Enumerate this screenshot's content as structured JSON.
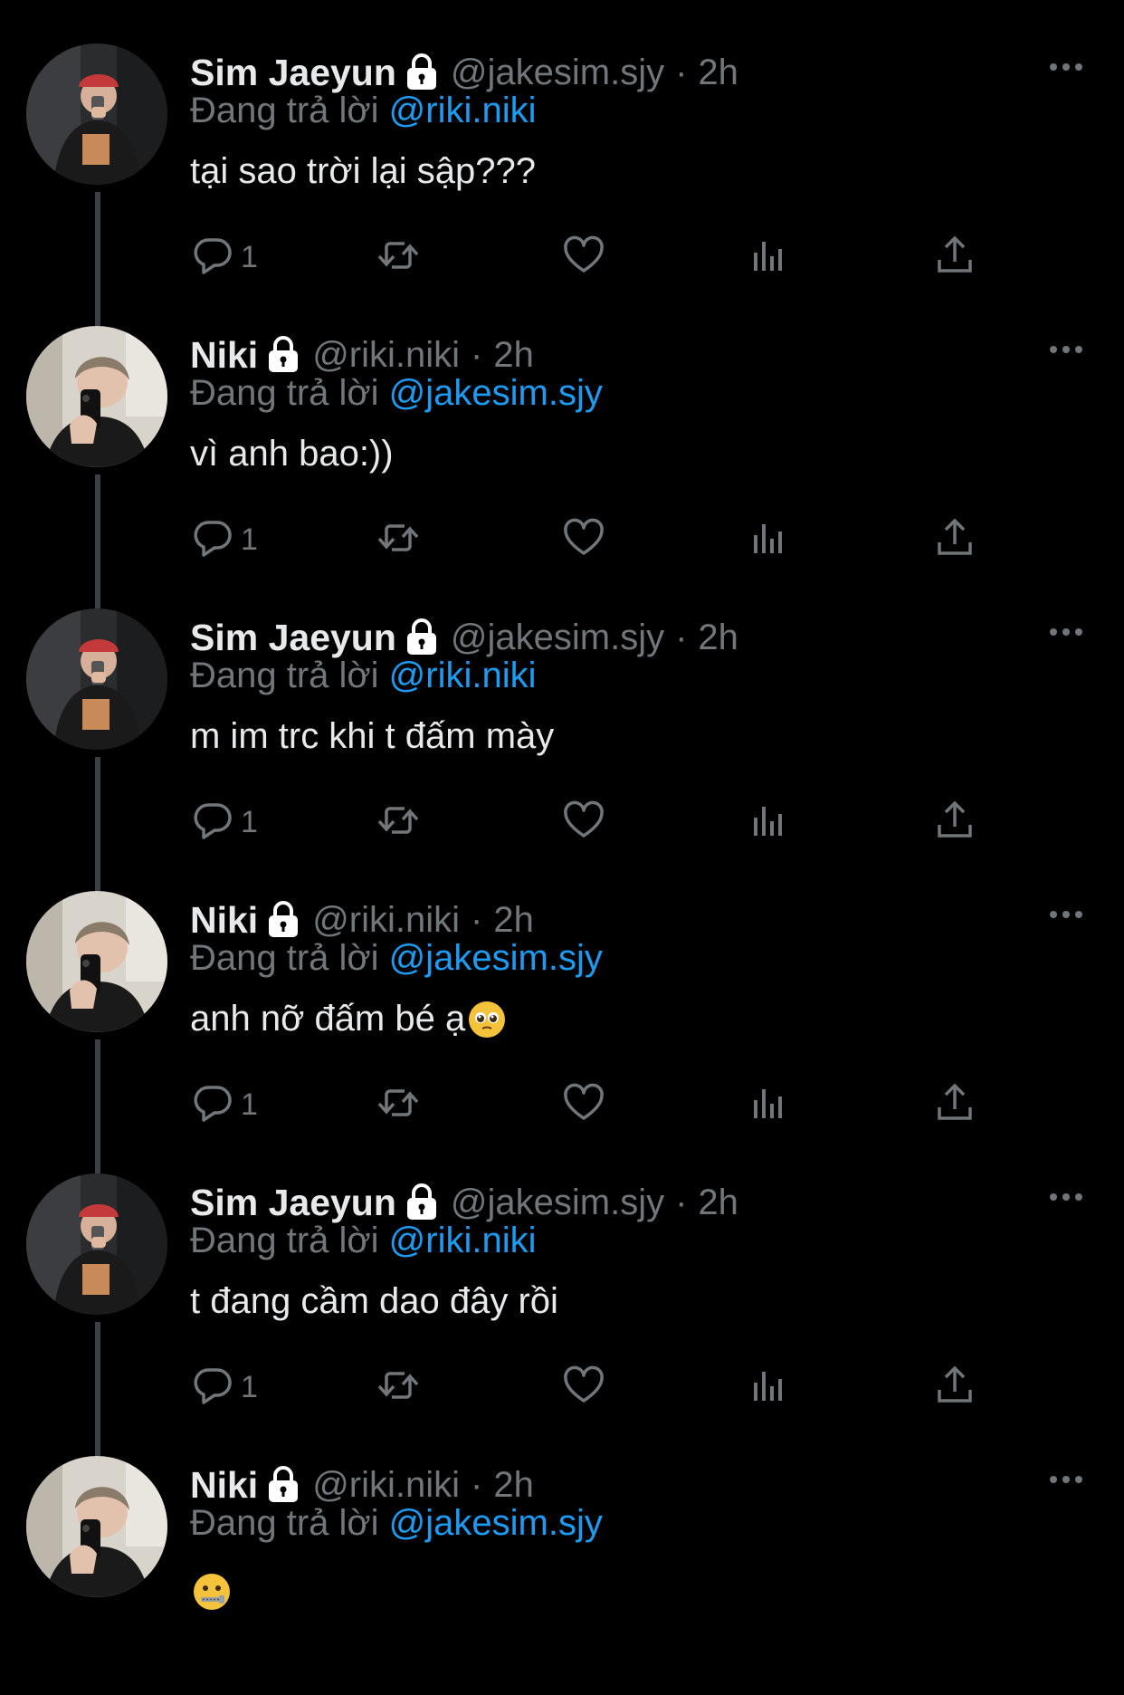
{
  "tweets": [
    {
      "name": "Sim Jaeyun",
      "handle": "@jakesim.sjy",
      "time": "2h",
      "reply_prefix": "Đang trả lời",
      "reply_to": "@riki.niki",
      "text": "tại sao trời lại sập???",
      "reply_count": "1",
      "avatar": "jake-avatar",
      "emoji": ""
    },
    {
      "name": "Niki",
      "handle": "@riki.niki",
      "time": "2h",
      "reply_prefix": "Đang trả lời",
      "reply_to": "@jakesim.sjy",
      "text": "vì anh bao:))",
      "reply_count": "1",
      "avatar": "niki-avatar",
      "emoji": ""
    },
    {
      "name": "Sim Jaeyun",
      "handle": "@jakesim.sjy",
      "time": "2h",
      "reply_prefix": "Đang trả lời",
      "reply_to": "@riki.niki",
      "text": "m im trc khi t đấm mày",
      "reply_count": "1",
      "avatar": "jake-avatar",
      "emoji": ""
    },
    {
      "name": "Niki",
      "handle": "@riki.niki",
      "time": "2h",
      "reply_prefix": "Đang trả lời",
      "reply_to": "@jakesim.sjy",
      "text": "anh nỡ đấm bé ạ",
      "reply_count": "1",
      "avatar": "niki-avatar",
      "emoji": "pleading-face-emoji"
    },
    {
      "name": "Sim Jaeyun",
      "handle": "@jakesim.sjy",
      "time": "2h",
      "reply_prefix": "Đang trả lời",
      "reply_to": "@riki.niki",
      "text": "t đang cầm dao đây rồi",
      "reply_count": "1",
      "avatar": "jake-avatar",
      "emoji": ""
    },
    {
      "name": "Niki",
      "handle": "@riki.niki",
      "time": "2h",
      "reply_prefix": "Đang trả lời",
      "reply_to": "@jakesim.sjy",
      "text": "",
      "reply_count": "",
      "avatar": "niki-avatar",
      "emoji": "zipper-mouth-emoji"
    }
  ],
  "icons": {
    "lock": "lock-icon",
    "more": "more-options-icon",
    "reply": "reply-icon",
    "retweet": "retweet-icon",
    "like": "heart-icon",
    "views": "views-icon",
    "share": "share-icon"
  },
  "colors": {
    "background": "#000000",
    "text": "#e7e9ea",
    "muted": "#71767b",
    "link": "#1d9bf0",
    "thread_line": "#3b4047"
  }
}
